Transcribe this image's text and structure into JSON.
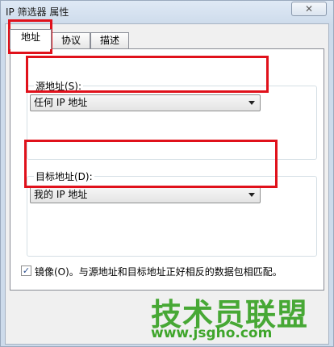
{
  "window": {
    "title": "IP 筛选器 属性",
    "close_symbol": "✕"
  },
  "tabs": [
    {
      "label": "地址",
      "active": true
    },
    {
      "label": "协议",
      "active": false
    },
    {
      "label": "描述",
      "active": false
    }
  ],
  "source_group": {
    "label": "源地址(S):",
    "value": "任何 IP 地址"
  },
  "dest_group": {
    "label": "目标地址(D):",
    "value": "我的 IP 地址"
  },
  "mirror_checkbox": {
    "checked": true,
    "check_symbol": "✓",
    "label": "镜像(O)。与源地址和目标地址正好相反的数据包相匹配。"
  },
  "watermark": {
    "text": "技术员联盟",
    "url": "www.jsgho.com"
  },
  "colors": {
    "highlight": "#e0111b",
    "watermark": "#3fa52b"
  }
}
